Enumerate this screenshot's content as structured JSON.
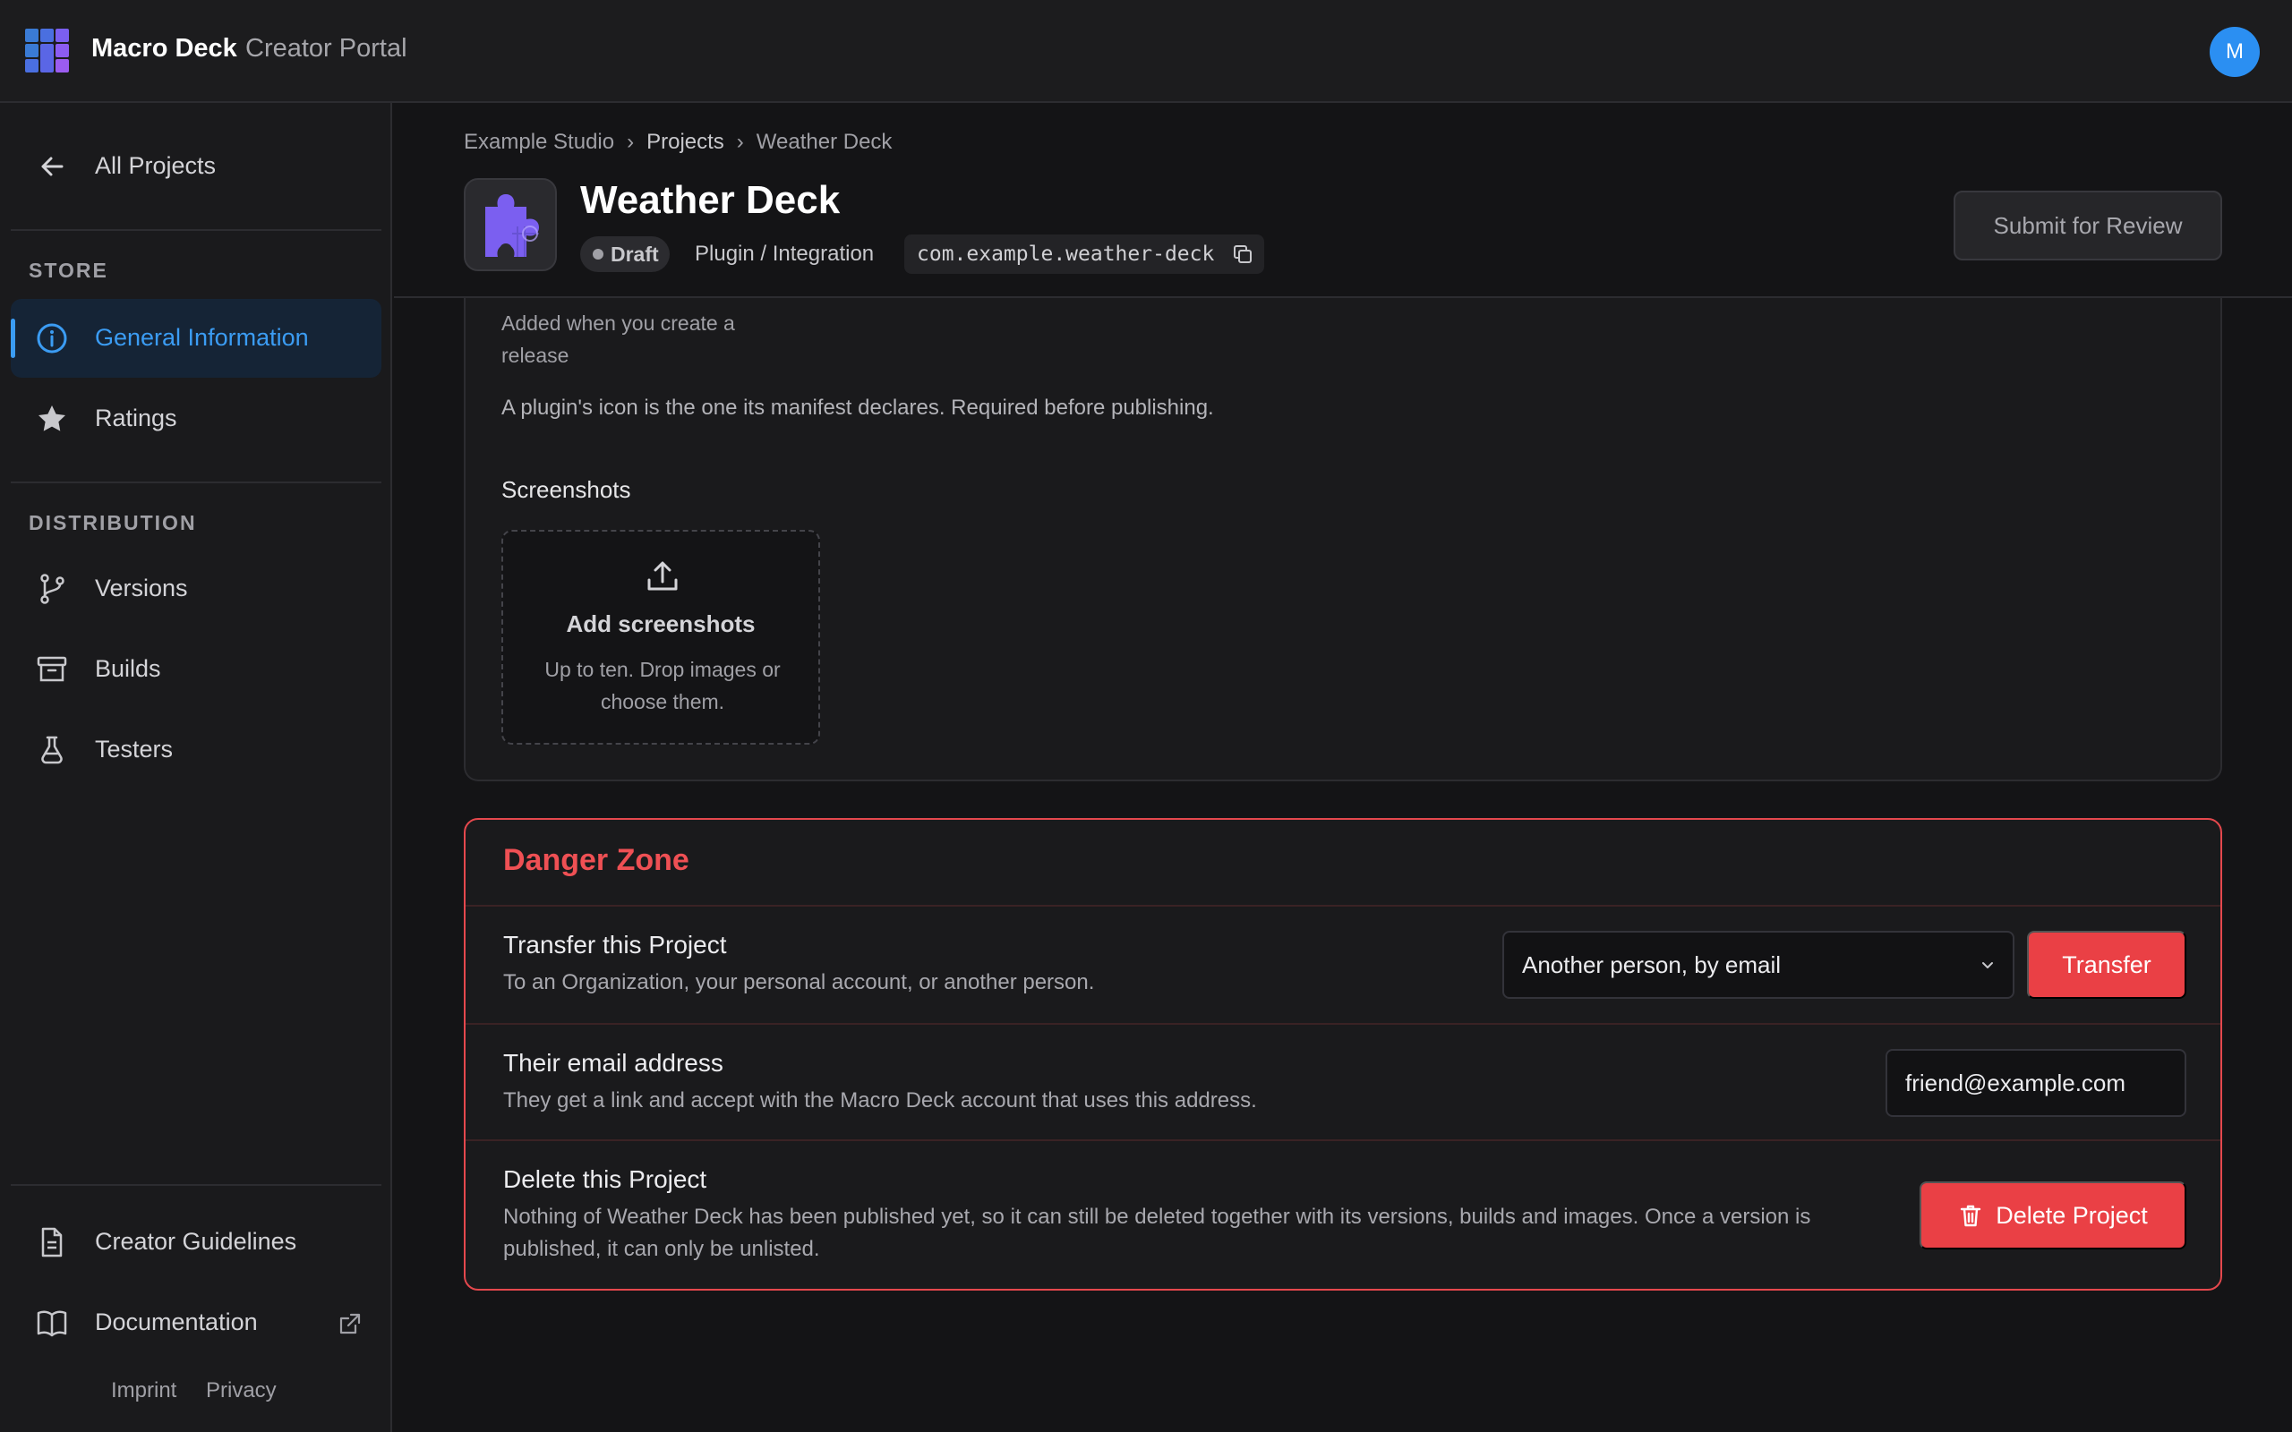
{
  "header": {
    "brand": "Macro Deck",
    "brand_sub": "Creator Portal",
    "avatar_initial": "M"
  },
  "sidebar": {
    "back_label": "All Projects",
    "store_heading": "STORE",
    "store_items": [
      {
        "label": "General Information",
        "icon": "info-icon",
        "active": true
      },
      {
        "label": "Ratings",
        "icon": "star-icon",
        "active": false
      }
    ],
    "distribution_heading": "DISTRIBUTION",
    "distribution_items": [
      {
        "label": "Versions",
        "icon": "branch-icon"
      },
      {
        "label": "Builds",
        "icon": "archive-icon"
      },
      {
        "label": "Testers",
        "icon": "flask-icon"
      }
    ],
    "bottom_items": [
      {
        "label": "Creator Guidelines",
        "icon": "document-icon"
      },
      {
        "label": "Documentation",
        "icon": "book-icon",
        "external": true
      }
    ],
    "footer_links": [
      "Imprint",
      "Privacy"
    ]
  },
  "breadcrumb": [
    "Example Studio",
    "Projects",
    "Weather Deck"
  ],
  "project": {
    "title": "Weather Deck",
    "status": "Draft",
    "type": "Plugin / Integration",
    "package_id": "com.example.weather-deck",
    "submit_label": "Submit for Review"
  },
  "general": {
    "icon_help": "Added when you create a release",
    "icon_note": "A plugin's icon is the one its manifest declares. Required before publishing.",
    "screenshots_label": "Screenshots",
    "add_title": "Add screenshots",
    "add_sub": "Up to ten. Drop images or choose them."
  },
  "danger_zone": {
    "title": "Danger Zone",
    "transfer": {
      "title": "Transfer this Project",
      "desc": "To an Organization, your personal account, or another person.",
      "select_value": "Another person, by email",
      "button": "Transfer"
    },
    "email": {
      "title": "Their email address",
      "desc": "They get a link and accept with the Macro Deck account that uses this address.",
      "value": "friend@example.com"
    },
    "delete": {
      "title": "Delete this Project",
      "desc": "Nothing of Weather Deck has been published yet, so it can still be deleted together with its versions, builds and images. Once a version is published, it can only be unlisted.",
      "button": "Delete Project"
    }
  },
  "colors": {
    "accent": "#3b9cf3",
    "danger": "#ea4045",
    "background": "#141416"
  }
}
